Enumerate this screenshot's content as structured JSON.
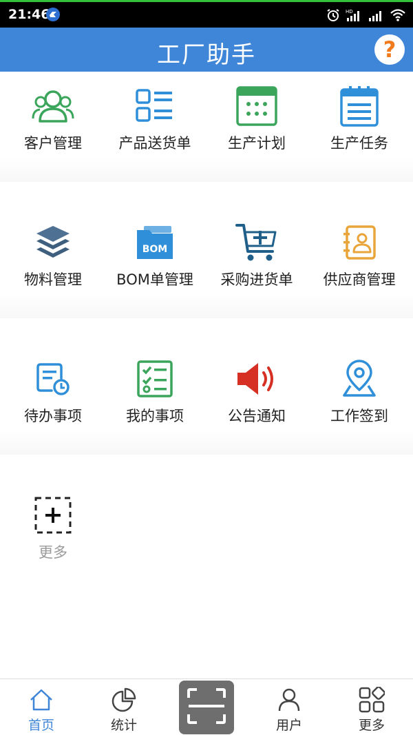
{
  "status_bar": {
    "time": "21:46"
  },
  "header": {
    "title": "工厂助手",
    "help_label": "?"
  },
  "colors": {
    "accent": "#3f86d8",
    "green": "#3aa55b",
    "blue": "#2f8fd8",
    "orange": "#e9a53a",
    "red": "#d63024"
  },
  "grid": {
    "items": [
      {
        "label": "客户管理",
        "icon": "customers-icon"
      },
      {
        "label": "产品送货单",
        "icon": "list-icon"
      },
      {
        "label": "生产计划",
        "icon": "calendar-icon"
      },
      {
        "label": "生产任务",
        "icon": "notepad-icon"
      },
      {
        "label": "物料管理",
        "icon": "layers-icon"
      },
      {
        "label": "BOM单管理",
        "icon": "bom-folder-icon"
      },
      {
        "label": "采购进货单",
        "icon": "cart-add-icon"
      },
      {
        "label": "供应商管理",
        "icon": "contact-card-icon"
      },
      {
        "label": "待办事项",
        "icon": "todo-clock-icon"
      },
      {
        "label": "我的事项",
        "icon": "checklist-icon"
      },
      {
        "label": "公告通知",
        "icon": "speaker-icon"
      },
      {
        "label": "工作签到",
        "icon": "location-pin-icon"
      },
      {
        "label": "更多",
        "icon": "add-box-icon"
      }
    ]
  },
  "tabbar": {
    "tabs": [
      {
        "label": "首页",
        "icon": "home-icon",
        "active": true
      },
      {
        "label": "统计",
        "icon": "pie-chart-icon"
      },
      {
        "label": "用户",
        "icon": "user-icon"
      },
      {
        "label": "更多",
        "icon": "apps-icon"
      }
    ]
  }
}
